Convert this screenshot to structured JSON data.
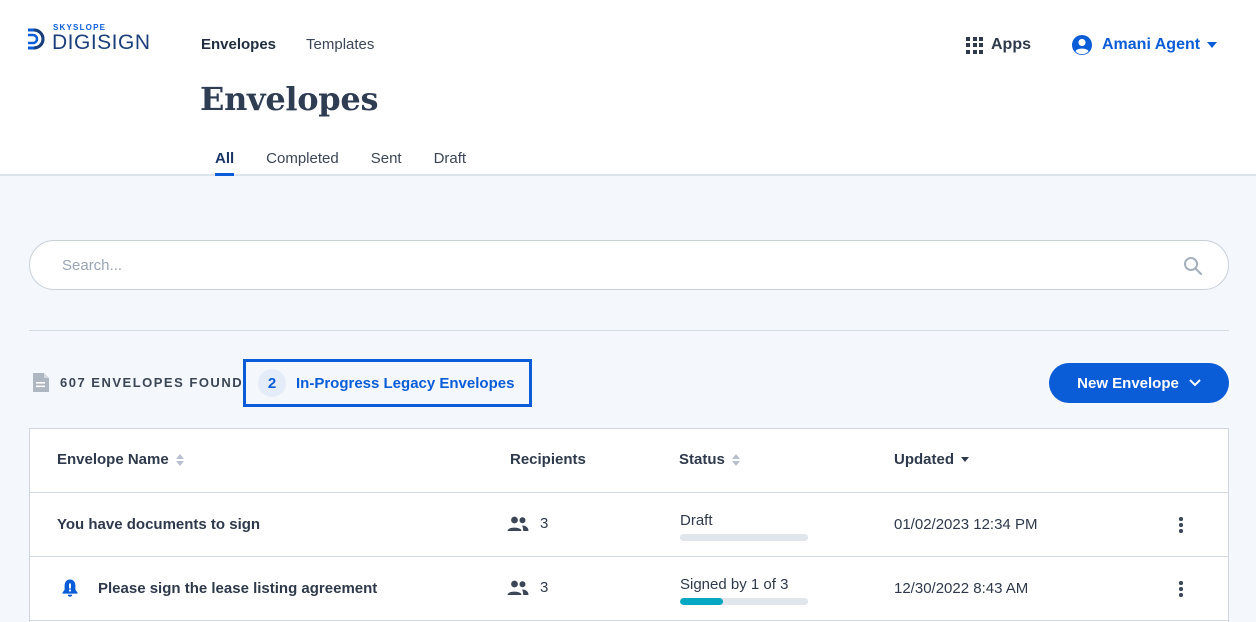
{
  "brand": {
    "small": "SKYSLOPE",
    "name": "DIGISIGN",
    "color": "#0b5cd7"
  },
  "nav": {
    "envelopes": "Envelopes",
    "templates": "Templates"
  },
  "apps": {
    "label": "Apps",
    "icon": "grid-icon"
  },
  "user": {
    "name": "Amani Agent",
    "icon": "user-circle-icon"
  },
  "page": {
    "title": "Envelopes"
  },
  "tabs": [
    {
      "label": "All",
      "active": true
    },
    {
      "label": "Completed",
      "active": false
    },
    {
      "label": "Sent",
      "active": false
    },
    {
      "label": "Draft",
      "active": false
    }
  ],
  "search": {
    "placeholder": "Search...",
    "value": "",
    "icon": "search-icon"
  },
  "summary": {
    "found_label": "607 ENVELOPES FOUND",
    "legacy_count": "2",
    "legacy_label": "In-Progress Legacy Envelopes"
  },
  "new_envelope": {
    "label": "New Envelope"
  },
  "table": {
    "headers": {
      "name": "Envelope Name",
      "recipients": "Recipients",
      "status": "Status",
      "updated": "Updated"
    },
    "sort": {
      "active_column": "updated",
      "direction": "descending"
    },
    "rows": [
      {
        "name": "You have documents to sign",
        "alert": false,
        "recipients": "3",
        "status": "Draft",
        "progress": 0,
        "updated": "01/02/2023 12:34 PM"
      },
      {
        "name": "Please sign the lease listing agreement",
        "alert": true,
        "recipients": "3",
        "status": "Signed by 1 of 3",
        "progress": 0.3333,
        "updated": "12/30/2022 8:43 AM"
      }
    ]
  },
  "colors": {
    "accent": "#0b5cd7",
    "progress": "#06a7c0",
    "background": "#f4f7fb"
  }
}
